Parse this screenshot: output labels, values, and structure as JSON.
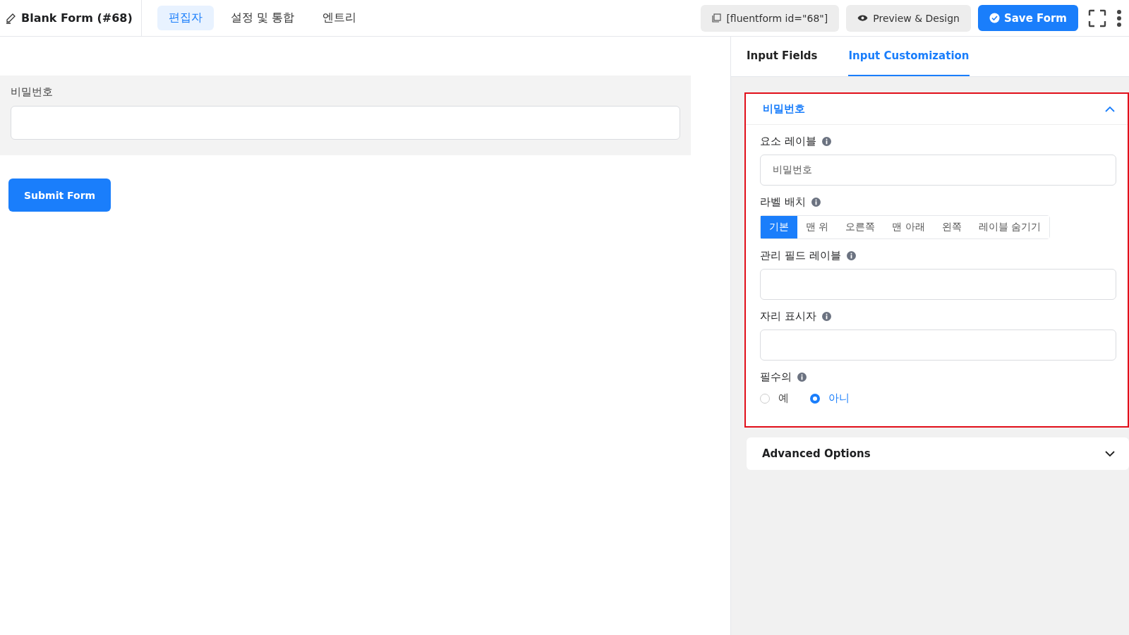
{
  "header": {
    "title": "Blank Form (#68)",
    "nav_tabs": [
      {
        "label": "편집자",
        "selected": true
      },
      {
        "label": "설정 및 통합",
        "selected": false
      },
      {
        "label": "엔트리",
        "selected": false
      }
    ],
    "shortcode": "[fluentform id=\"68\"]",
    "preview_button": "Preview & Design",
    "save_button": "Save Form"
  },
  "canvas": {
    "field_label": "비밀번호",
    "submit_button": "Submit Form"
  },
  "sidebar": {
    "tabs": [
      {
        "label": "Input Fields",
        "selected": false
      },
      {
        "label": "Input Customization",
        "selected": true
      }
    ],
    "section": {
      "title": "비밀번호",
      "expanded": true,
      "fields": [
        {
          "kind": "text",
          "label": "요소 레이블",
          "value": "비밀번호"
        },
        {
          "kind": "segmented",
          "label": "라벨 배치",
          "options": [
            {
              "label": "기본",
              "selected": true
            },
            {
              "label": "맨 위",
              "selected": false
            },
            {
              "label": "오른쪽",
              "selected": false
            },
            {
              "label": "맨 아래",
              "selected": false
            },
            {
              "label": "왼쪽",
              "selected": false
            },
            {
              "label": "레이블 숨기기",
              "selected": false
            }
          ]
        },
        {
          "kind": "text",
          "label": "관리 필드 레이블"
        },
        {
          "kind": "text",
          "label": "자리 표시자"
        },
        {
          "kind": "radio",
          "label": "필수의",
          "options": [
            {
              "label": "예",
              "selected": false
            },
            {
              "label": "아니",
              "selected": true
            }
          ]
        }
      ]
    },
    "advanced": {
      "title": "Advanced Options",
      "expanded": false
    }
  }
}
